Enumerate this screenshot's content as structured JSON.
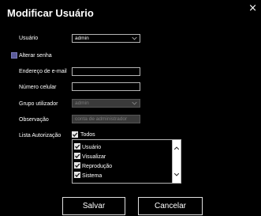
{
  "dialog": {
    "title": "Modificar Usuário",
    "close_glyph": "×"
  },
  "form": {
    "user_label": "Usuário",
    "user_value": "admin",
    "change_password_label": "Alterar senha",
    "change_password_checked": false,
    "email_label": "Endereço de e-mail",
    "email_value": "",
    "phone_label": "Número celular",
    "phone_value": "",
    "group_label": "Grupo utilizador",
    "group_value": "admin",
    "note_label": "Observação",
    "note_value": "conta de administrador",
    "auth_label": "Lista Autorização",
    "all_label": "Todos",
    "all_checked": true,
    "permissions": [
      {
        "label": "Usuário",
        "checked": true
      },
      {
        "label": "Visualizar",
        "checked": true
      },
      {
        "label": "Reprodução",
        "checked": true
      },
      {
        "label": "Sistema",
        "checked": true
      }
    ]
  },
  "buttons": {
    "save": "Salvar",
    "cancel": "Cancelar"
  },
  "icons": {
    "close": "close-icon",
    "checkbox": "checkmark-icon",
    "dropdown": "chevron-down-icon",
    "scroll_up": "chevron-up-icon",
    "scroll_down": "chevron-down-icon"
  }
}
